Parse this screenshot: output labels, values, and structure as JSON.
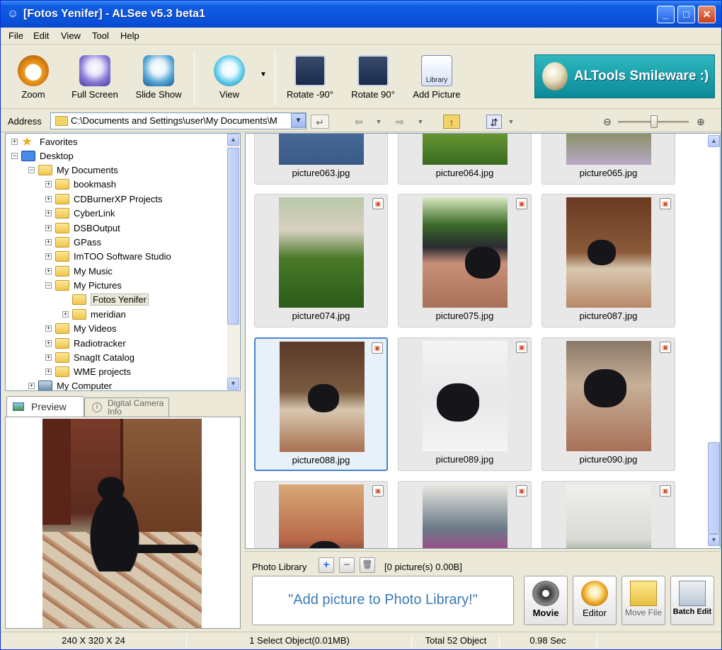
{
  "window": {
    "title": "[Fotos Yenifer] - ALSee v5.3 beta1"
  },
  "menu": [
    "File",
    "Edit",
    "View",
    "Tool",
    "Help"
  ],
  "toolbar": {
    "zoom": "Zoom",
    "full_screen": "Full Screen",
    "slide_show": "Slide Show",
    "view": "View",
    "rotate_ccw": "Rotate -90°",
    "rotate_cw": "Rotate 90°",
    "add_picture": "Add Picture",
    "library_icon_text": "Library"
  },
  "banner": {
    "text": "ALTools Smileware :)"
  },
  "address": {
    "label": "Address",
    "value": "C:\\Documents and Settings\\user\\My Documents\\M"
  },
  "tree": {
    "items": [
      {
        "label": "Favorites"
      },
      {
        "label": "Desktop"
      },
      {
        "label": "My Documents"
      },
      {
        "label": "bookmash"
      },
      {
        "label": "CDBurnerXP Projects"
      },
      {
        "label": "CyberLink"
      },
      {
        "label": "DSBOutput"
      },
      {
        "label": "GPass"
      },
      {
        "label": "ImTOO Software Studio"
      },
      {
        "label": "My Music"
      },
      {
        "label": "My Pictures"
      },
      {
        "label": "Fotos Yenifer"
      },
      {
        "label": "meridian"
      },
      {
        "label": "My Videos"
      },
      {
        "label": "Radiotracker"
      },
      {
        "label": "SnagIt Catalog"
      },
      {
        "label": "WME projects"
      },
      {
        "label": "My Computer"
      }
    ]
  },
  "preview_tabs": {
    "preview": "Preview",
    "camera": "Digital Camera Info"
  },
  "thumbnails": [
    {
      "name": "picture063.jpg"
    },
    {
      "name": "picture064.jpg"
    },
    {
      "name": "picture065.jpg"
    },
    {
      "name": "picture074.jpg"
    },
    {
      "name": "picture075.jpg"
    },
    {
      "name": "picture087.jpg"
    },
    {
      "name": "picture088.jpg"
    },
    {
      "name": "picture089.jpg"
    },
    {
      "name": "picture090.jpg"
    },
    {
      "name": ""
    },
    {
      "name": ""
    },
    {
      "name": ""
    }
  ],
  "library": {
    "title": "Photo Library",
    "count": "[0 picture(s) 0.00B]",
    "drop_hint": "\"Add picture to Photo Library!\"",
    "buttons": {
      "movie": "Movie",
      "editor": "Editor",
      "move_file": "Move File",
      "batch_edit": "Batch Edit"
    }
  },
  "status": {
    "dimensions": "240 X 320 X 24",
    "selection": "1 Select Object(0.01MB)",
    "total": "Total 52 Object",
    "time": "0.98 Sec"
  },
  "colors": {
    "accent": "#0A50D8",
    "selection": "#4A86C8",
    "library_text": "#3A7AB8"
  }
}
